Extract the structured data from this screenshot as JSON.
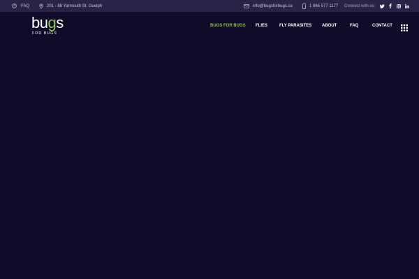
{
  "topbar": {
    "faq_label": "FAQ",
    "address": "201 - 86 Yarmouth St. Guelph",
    "email": "info@bugsforbugs.ca",
    "phone": "1 866 577 1177",
    "connect_label": "Connect with us:",
    "social_icons": [
      "twitter-icon",
      "facebook-icon",
      "instagram-icon",
      "linkedin-icon"
    ]
  },
  "logo": {
    "word_main": "bu",
    "word_accent": "g",
    "word_end": "s",
    "subtitle": "FOR BUGS"
  },
  "nav": {
    "items": [
      {
        "label": "BUGS FOR BUGS",
        "active": true
      },
      {
        "label": "FLIES",
        "active": false
      },
      {
        "label": "FLY PARASITES",
        "active": false
      },
      {
        "label": "ABOUT",
        "active": false
      },
      {
        "label": "FAQ",
        "active": false
      },
      {
        "label": "CONTACT",
        "active": false
      }
    ]
  },
  "colors": {
    "background": "#110a29",
    "topbar": "#2a2347",
    "accent": "#8bc34a",
    "text": "#ffffff"
  }
}
